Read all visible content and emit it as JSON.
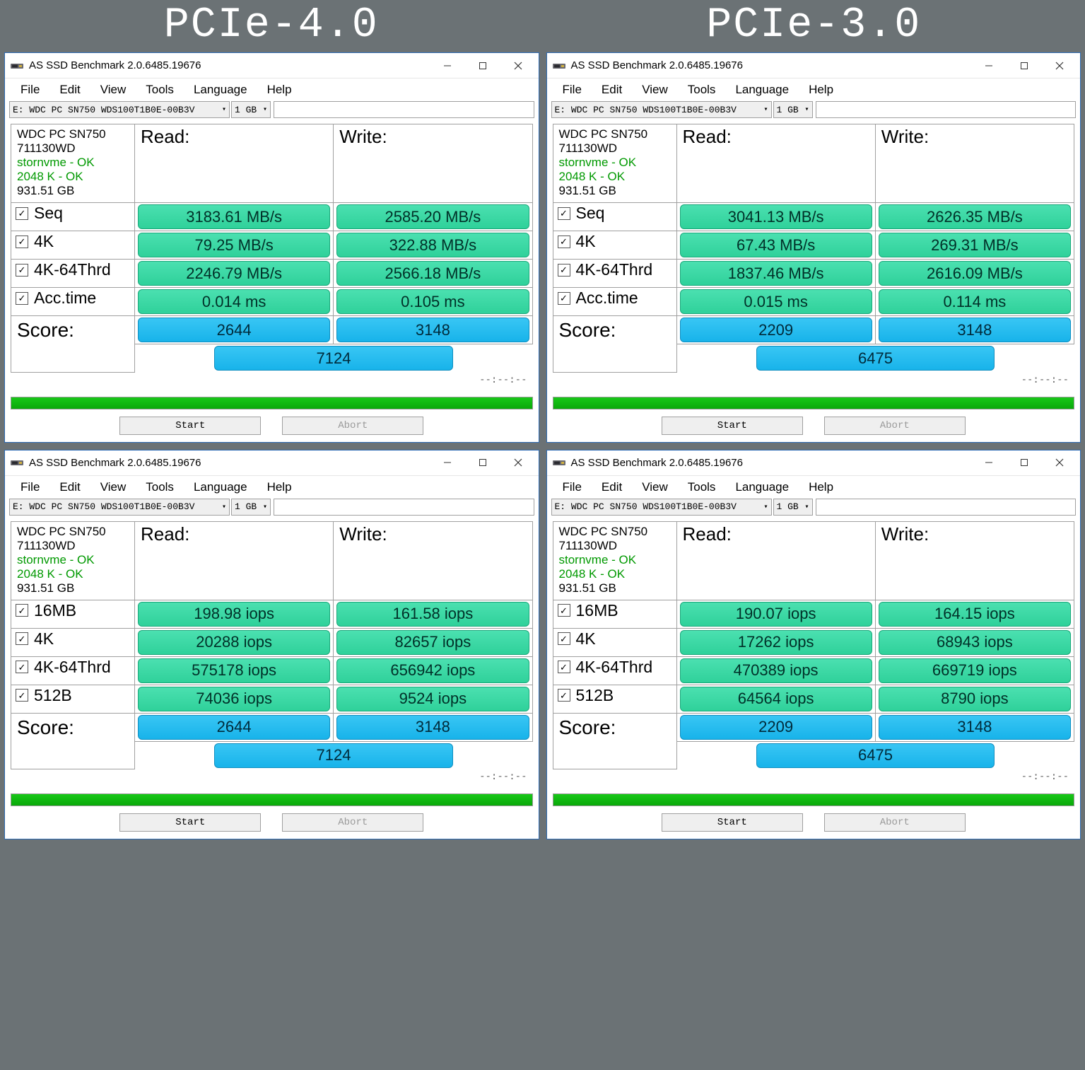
{
  "headers": {
    "left": "PCIe-4.0",
    "right": "PCIe-3.0"
  },
  "app_title": "AS SSD Benchmark 2.0.6485.19676",
  "menu": {
    "file": "File",
    "edit": "Edit",
    "view": "View",
    "tools": "Tools",
    "language": "Language",
    "help": "Help"
  },
  "drive_combo": "E: WDC PC SN750 WDS100T1B0E-00B3V",
  "size_combo": "1 GB",
  "drive_info": {
    "model": "WDC PC SN750",
    "fw": "711130WD",
    "driver": "stornvme - OK",
    "align": "2048 K - OK",
    "capacity": "931.51 GB"
  },
  "labels": {
    "read": "Read:",
    "write": "Write:",
    "score": "Score:",
    "start": "Start",
    "abort": "Abort",
    "timecode": "--:--:--"
  },
  "tests_mbs": {
    "rows": [
      "Seq",
      "4K",
      "4K-64Thrd",
      "Acc.time"
    ]
  },
  "tests_iops": {
    "rows": [
      "16MB",
      "4K",
      "4K-64Thrd",
      "512B"
    ]
  },
  "panels": [
    {
      "mode": "mbs",
      "read": [
        "3183.61 MB/s",
        "79.25 MB/s",
        "2246.79 MB/s",
        "0.014 ms"
      ],
      "write": [
        "2585.20 MB/s",
        "322.88 MB/s",
        "2566.18 MB/s",
        "0.105 ms"
      ],
      "score_read": "2644",
      "score_write": "3148",
      "score_total": "7124"
    },
    {
      "mode": "mbs",
      "read": [
        "3041.13 MB/s",
        "67.43 MB/s",
        "1837.46 MB/s",
        "0.015 ms"
      ],
      "write": [
        "2626.35 MB/s",
        "269.31 MB/s",
        "2616.09 MB/s",
        "0.114 ms"
      ],
      "score_read": "2209",
      "score_write": "3148",
      "score_total": "6475"
    },
    {
      "mode": "iops",
      "read": [
        "198.98 iops",
        "20288 iops",
        "575178 iops",
        "74036 iops"
      ],
      "write": [
        "161.58 iops",
        "82657 iops",
        "656942 iops",
        "9524 iops"
      ],
      "score_read": "2644",
      "score_write": "3148",
      "score_total": "7124"
    },
    {
      "mode": "iops",
      "read": [
        "190.07 iops",
        "17262 iops",
        "470389 iops",
        "64564 iops"
      ],
      "write": [
        "164.15 iops",
        "68943 iops",
        "669719 iops",
        "8790 iops"
      ],
      "score_read": "2209",
      "score_write": "3148",
      "score_total": "6475"
    }
  ]
}
